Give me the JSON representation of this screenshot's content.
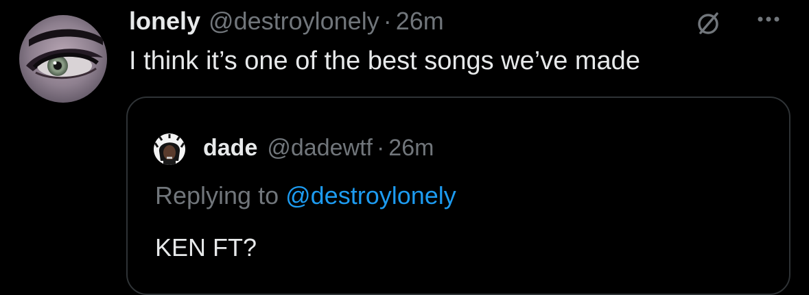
{
  "tweet": {
    "display_name": "lonely",
    "handle": "@destroylonely",
    "separator": "·",
    "time": "26m",
    "text": "I think it’s one of the best songs we’ve made",
    "avatar_icon": "avatar-eye-photo"
  },
  "actions": {
    "grok_icon": "grok-slash-circle-icon",
    "more_icon": "more-dots-icon"
  },
  "quoted": {
    "display_name": "dade",
    "handle": "@dadewtf",
    "separator": "·",
    "time": "26m",
    "replying_prefix": "Replying to ",
    "replying_mention": "@destroylonely",
    "text": "KEN FT?",
    "avatar_icon": "avatar-person-photo"
  },
  "colors": {
    "background": "#000000",
    "primary_text": "#e7e9ea",
    "secondary_text": "#71767b",
    "link": "#1d9bf0",
    "border": "#2f3336"
  }
}
